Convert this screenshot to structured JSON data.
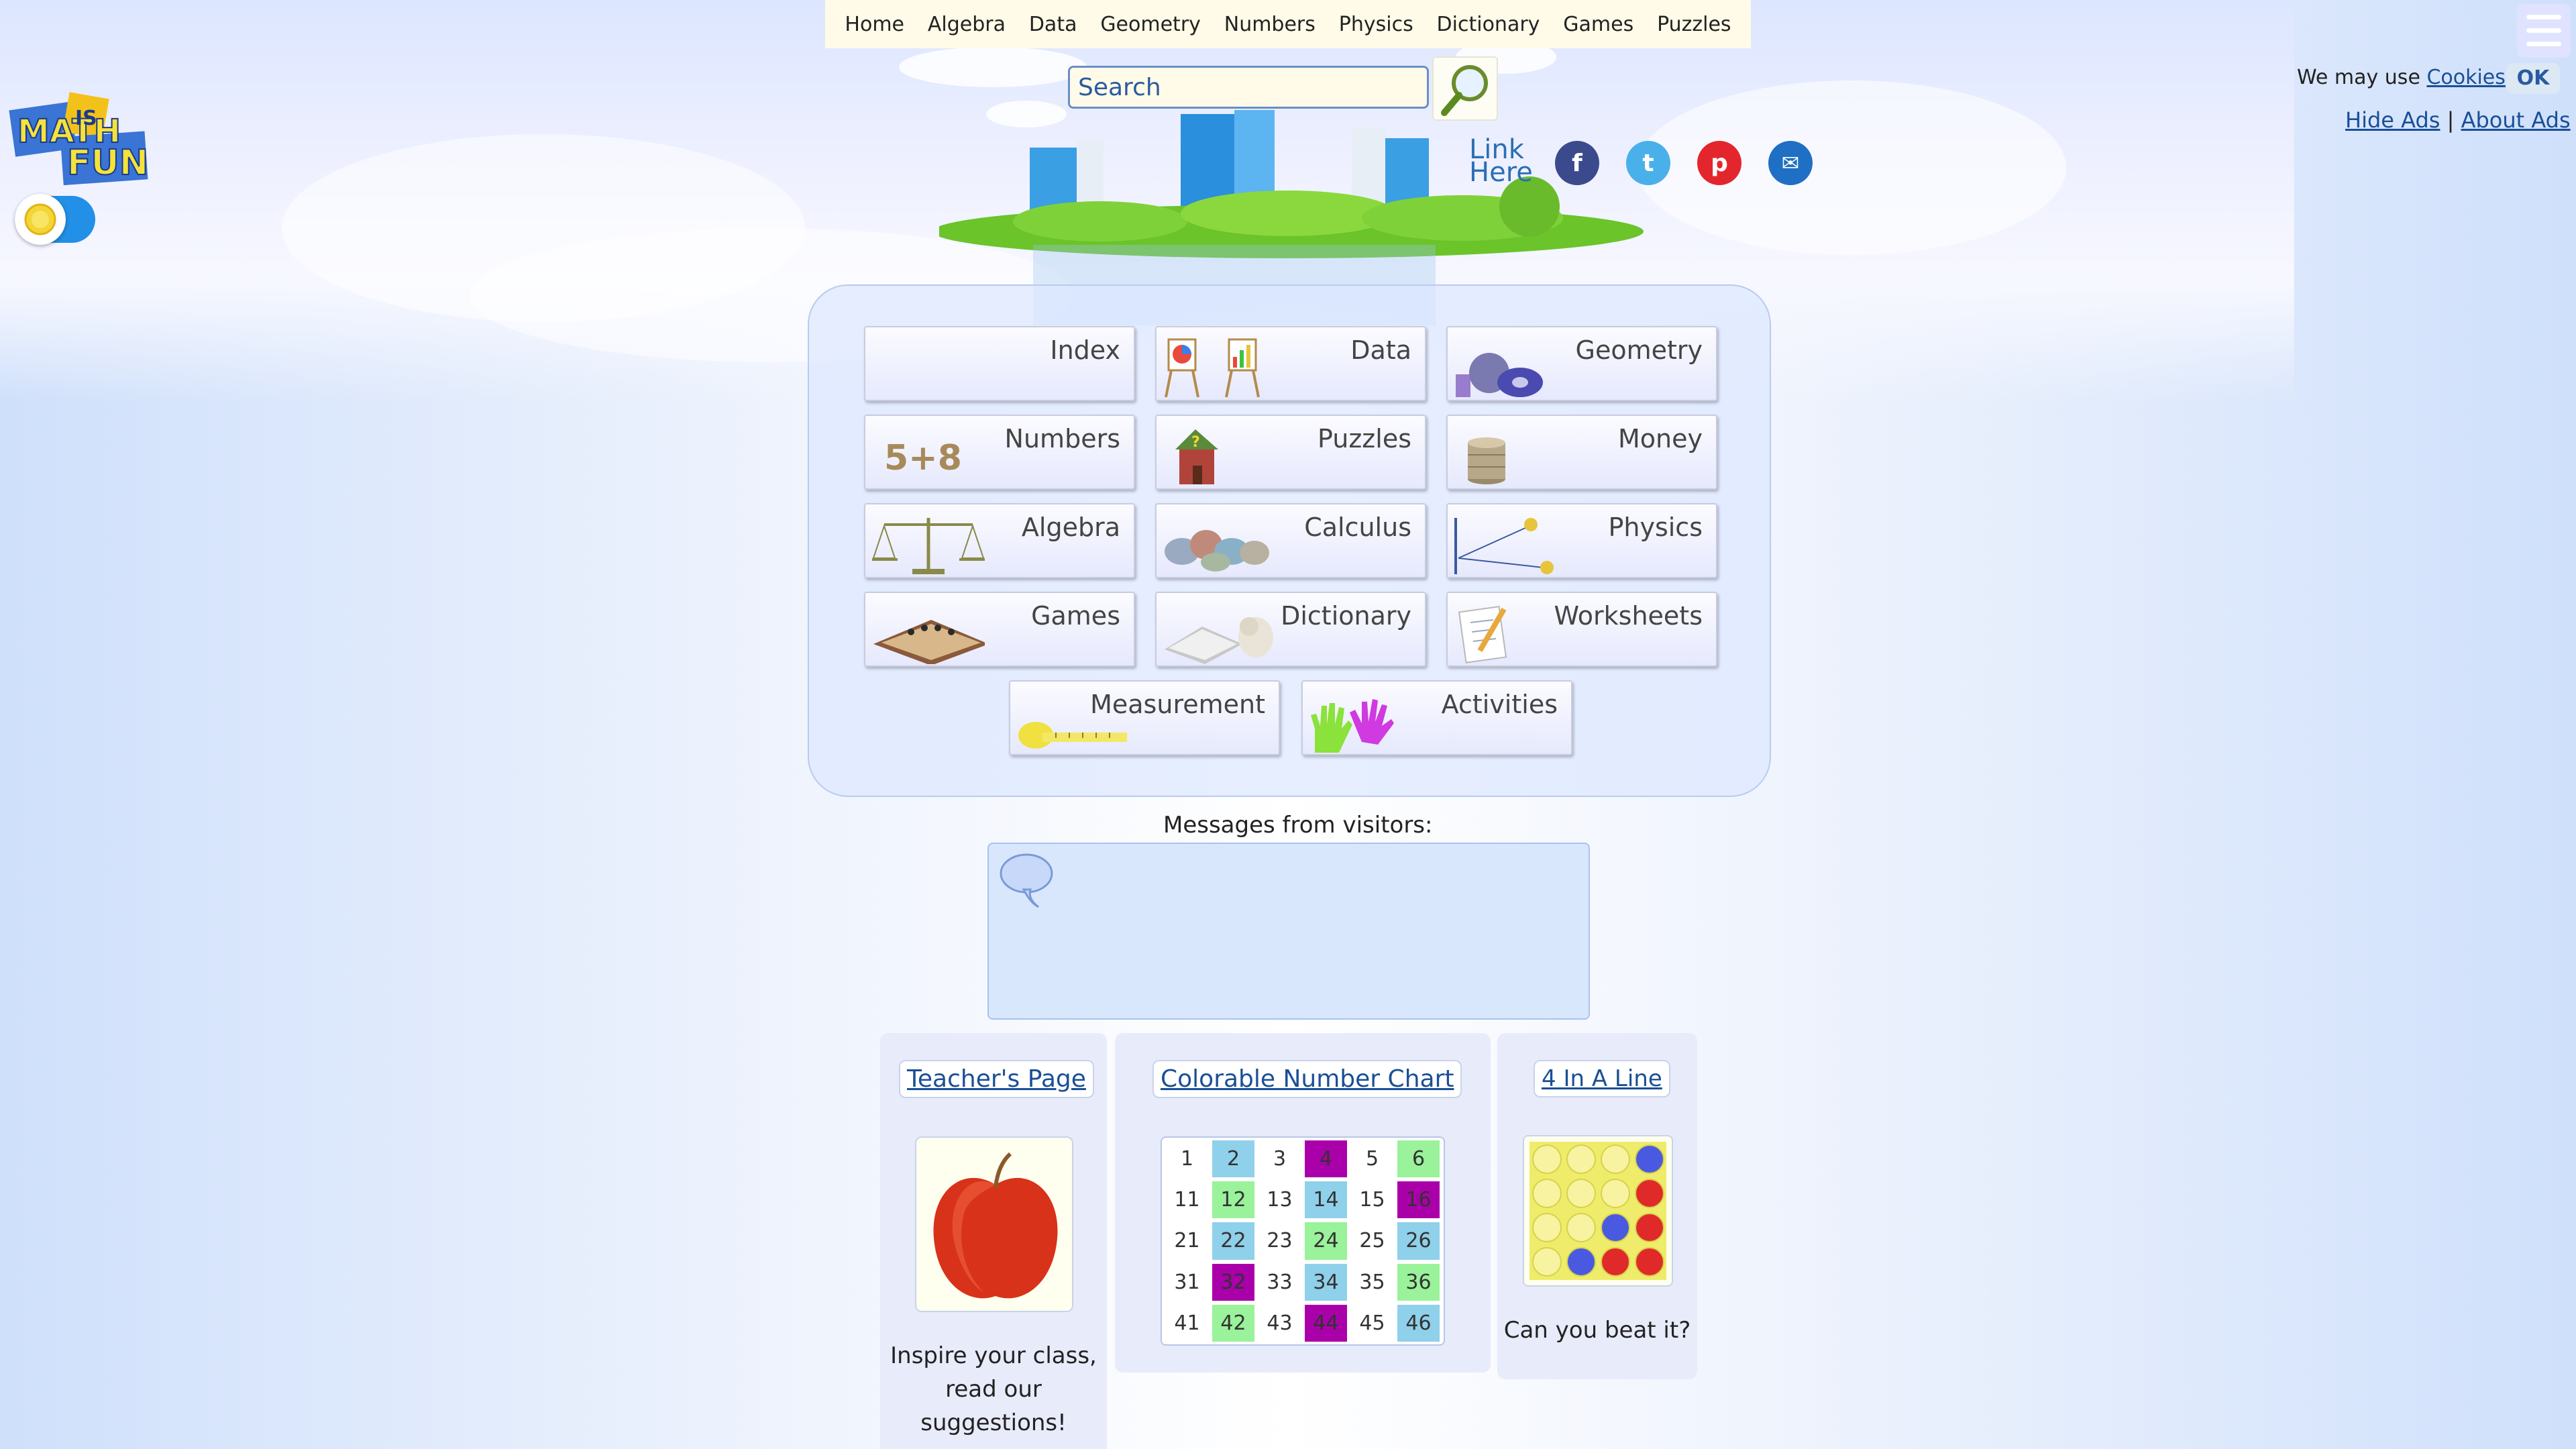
{
  "nav": [
    "Home",
    "Algebra",
    "Data",
    "Geometry",
    "Numbers",
    "Physics",
    "Dictionary",
    "Games",
    "Puzzles"
  ],
  "search": {
    "placeholder": "Search"
  },
  "link_here": [
    "Link",
    "Here"
  ],
  "social": {
    "facebook": "f",
    "twitter": "t",
    "pinterest": "p",
    "email": "✉"
  },
  "cookie": {
    "text": "We may use ",
    "link": "Cookies",
    "ok": "OK"
  },
  "ads": {
    "hide": "Hide Ads",
    "separator": "|",
    "about": "About Ads"
  },
  "logo": {
    "text": "MATH IS FUN"
  },
  "tiles": [
    {
      "label": "Index"
    },
    {
      "label": "Data"
    },
    {
      "label": "Geometry"
    },
    {
      "label": "Numbers"
    },
    {
      "label": "Puzzles"
    },
    {
      "label": "Money"
    },
    {
      "label": "Algebra"
    },
    {
      "label": "Calculus"
    },
    {
      "label": "Physics"
    },
    {
      "label": "Games"
    },
    {
      "label": "Dictionary"
    },
    {
      "label": "Worksheets"
    },
    {
      "label": "Measurement"
    },
    {
      "label": "Activities"
    }
  ],
  "numbers_icon_text": "5+8",
  "messages": {
    "label": "Messages from visitors:"
  },
  "cards": {
    "teacher": {
      "title": "Teacher's Page",
      "text": [
        "Inspire your class,",
        "read our",
        "suggestions!"
      ]
    },
    "chart": {
      "title": "Colorable Number Chart",
      "rows": [
        [
          "1",
          "2",
          "3",
          "4",
          "5",
          "6"
        ],
        [
          "11",
          "12",
          "13",
          "14",
          "15",
          "16"
        ],
        [
          "21",
          "22",
          "23",
          "24",
          "25",
          "26"
        ],
        [
          "31",
          "32",
          "33",
          "34",
          "35",
          "36"
        ],
        [
          "41",
          "42",
          "43",
          "44",
          "45",
          "46"
        ]
      ],
      "colors": [
        [
          "",
          "blue",
          "",
          "purple",
          "",
          "green"
        ],
        [
          "",
          "green",
          "",
          "blue",
          "",
          "purple"
        ],
        [
          "",
          "blue",
          "",
          "green",
          "",
          "blue"
        ],
        [
          "",
          "purple",
          "",
          "blue",
          "",
          "green"
        ],
        [
          "",
          "green",
          "",
          "purple",
          "",
          "blue"
        ]
      ]
    },
    "game": {
      "title": "4 In A Line",
      "text": "Can you beat it?",
      "board": [
        [
          "y",
          "y",
          "y",
          "b"
        ],
        [
          "y",
          "y",
          "y",
          "r"
        ],
        [
          "y",
          "y",
          "b",
          "r"
        ],
        [
          "y",
          "b",
          "r",
          "r"
        ]
      ]
    }
  }
}
